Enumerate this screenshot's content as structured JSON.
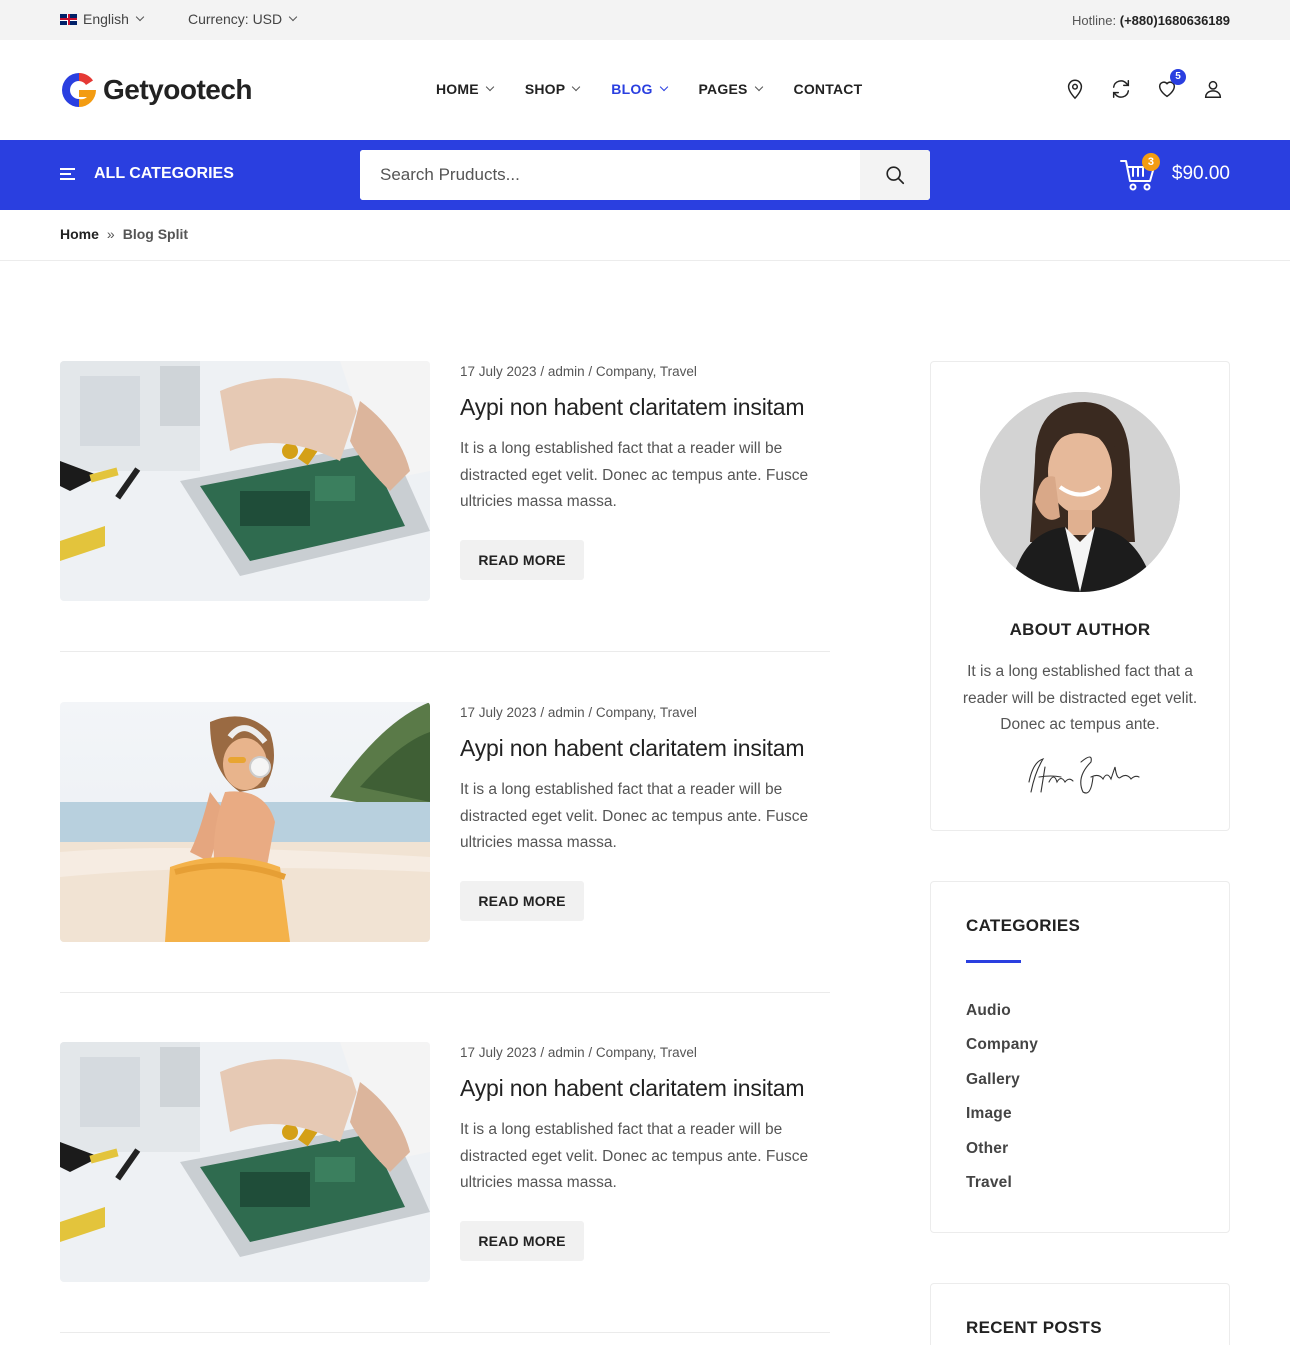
{
  "topbar": {
    "language": "English",
    "currency": "Currency: USD",
    "hotline_label": "Hotline:",
    "hotline_number": "(+880)1680636189"
  },
  "header": {
    "logo_text": "Getyootech",
    "nav": [
      {
        "label": "HOME",
        "has_dropdown": true
      },
      {
        "label": "SHOP",
        "has_dropdown": true
      },
      {
        "label": "BLOG",
        "has_dropdown": true,
        "active": true
      },
      {
        "label": "PAGES",
        "has_dropdown": true
      },
      {
        "label": "CONTACT",
        "has_dropdown": false
      }
    ],
    "icons": [
      "location-icon",
      "compare-icon",
      "wishlist-icon",
      "user-icon"
    ],
    "wishlist_count": "5"
  },
  "bluebar": {
    "all_categories": "ALL CATEGORIES",
    "search_placeholder": "Search Pruducts...",
    "cart_count": "3",
    "cart_total": "$90.00"
  },
  "breadcrumb": {
    "home": "Home",
    "current": "Blog Split"
  },
  "posts": [
    {
      "date": "17 July 2023",
      "author": "admin",
      "categories": "Company, Travel",
      "title": "Aypi non habent claritatem insitam",
      "excerpt": "It is a long established fact that a reader will be distracted eget velit. Donec ac tempus ante. Fusce ultricies massa massa.",
      "button": "READ MORE",
      "image": "laptop-repair"
    },
    {
      "date": "17 July 2023",
      "author": "admin",
      "categories": "Company, Travel",
      "title": "Aypi non habent claritatem insitam",
      "excerpt": "It is a long established fact that a reader will be distracted eget velit. Donec ac tempus ante. Fusce ultricies massa massa.",
      "button": "READ MORE",
      "image": "beach-headphones"
    },
    {
      "date": "17 July 2023",
      "author": "admin",
      "categories": "Company, Travel",
      "title": "Aypi non habent claritatem insitam",
      "excerpt": "It is a long established fact that a reader will be distracted eget velit. Donec ac tempus ante. Fusce ultricies massa massa.",
      "button": "READ MORE",
      "image": "laptop-repair"
    }
  ],
  "sidebar": {
    "author": {
      "title": "ABOUT AUTHOR",
      "text": "It is a long established fact that a reader will be distracted eget velit. Donec ac tempus ante.",
      "signature": "Author Signature"
    },
    "categories": {
      "title": "CATEGORIES",
      "items": [
        "Audio",
        "Company",
        "Gallery",
        "Image",
        "Other",
        "Travel"
      ]
    },
    "recent_posts": {
      "title": "RECENT POSTS"
    }
  },
  "colors": {
    "accent": "#2a3fe0",
    "cart_badge": "#f39c12",
    "topbar_bg": "#f3f3f3"
  }
}
